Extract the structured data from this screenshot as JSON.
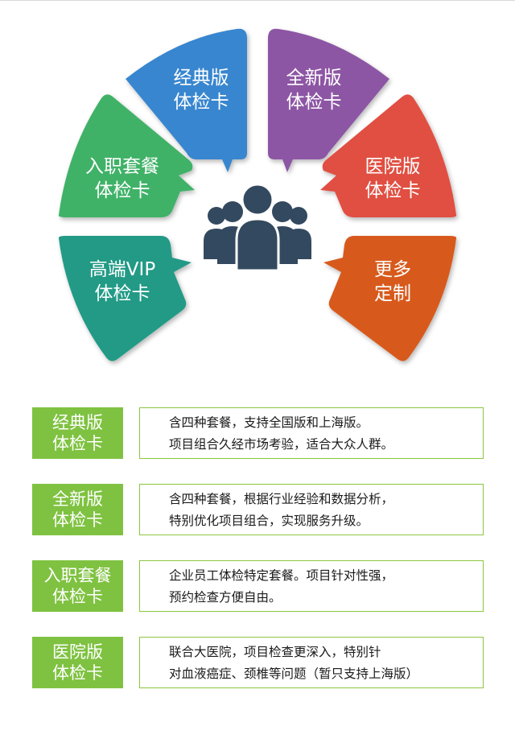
{
  "colors": {
    "classic": "#3786cf",
    "new": "#8d57a4",
    "onboarding": "#3fb268",
    "hospital": "#e04f43",
    "vip": "#249a86",
    "custom": "#d75a1d",
    "people_icon": "#33495f",
    "tag_green": "#7fc241",
    "border_green": "#8cc63f"
  },
  "wheel": {
    "center_icon": "people-group-icon",
    "petals": [
      {
        "key": "classic",
        "line1": "经典版",
        "line2": "体检卡"
      },
      {
        "key": "new",
        "line1": "全新版",
        "line2": "体检卡"
      },
      {
        "key": "onboarding",
        "line1": "入职套餐",
        "line2": "体检卡"
      },
      {
        "key": "hospital",
        "line1": "医院版",
        "line2": "体检卡"
      },
      {
        "key": "vip",
        "line1": "高端VIP",
        "line2": "体检卡"
      },
      {
        "key": "custom",
        "line1": "更多",
        "line2": "定制"
      }
    ]
  },
  "cards": [
    {
      "tag1": "经典版",
      "tag2": "体检卡",
      "desc1": "含四种套餐，支持全国版和上海版。",
      "desc2": "项目组合久经市场考验，适合大众人群。"
    },
    {
      "tag1": "全新版",
      "tag2": "体检卡",
      "desc1": "含四种套餐，根据行业经验和数据分析，",
      "desc2": "特别优化项目组合，实现服务升级。"
    },
    {
      "tag1": "入职套餐",
      "tag2": "体检卡",
      "desc1": "企业员工体检特定套餐。项目针对性强，",
      "desc2": "预约检查方便自由。"
    },
    {
      "tag1": "医院版",
      "tag2": "体检卡",
      "desc1": "联合大医院，项目检查更深入，特别针",
      "desc2": "对血液癌症、颈椎等问题（暂只支持上海版）"
    }
  ]
}
